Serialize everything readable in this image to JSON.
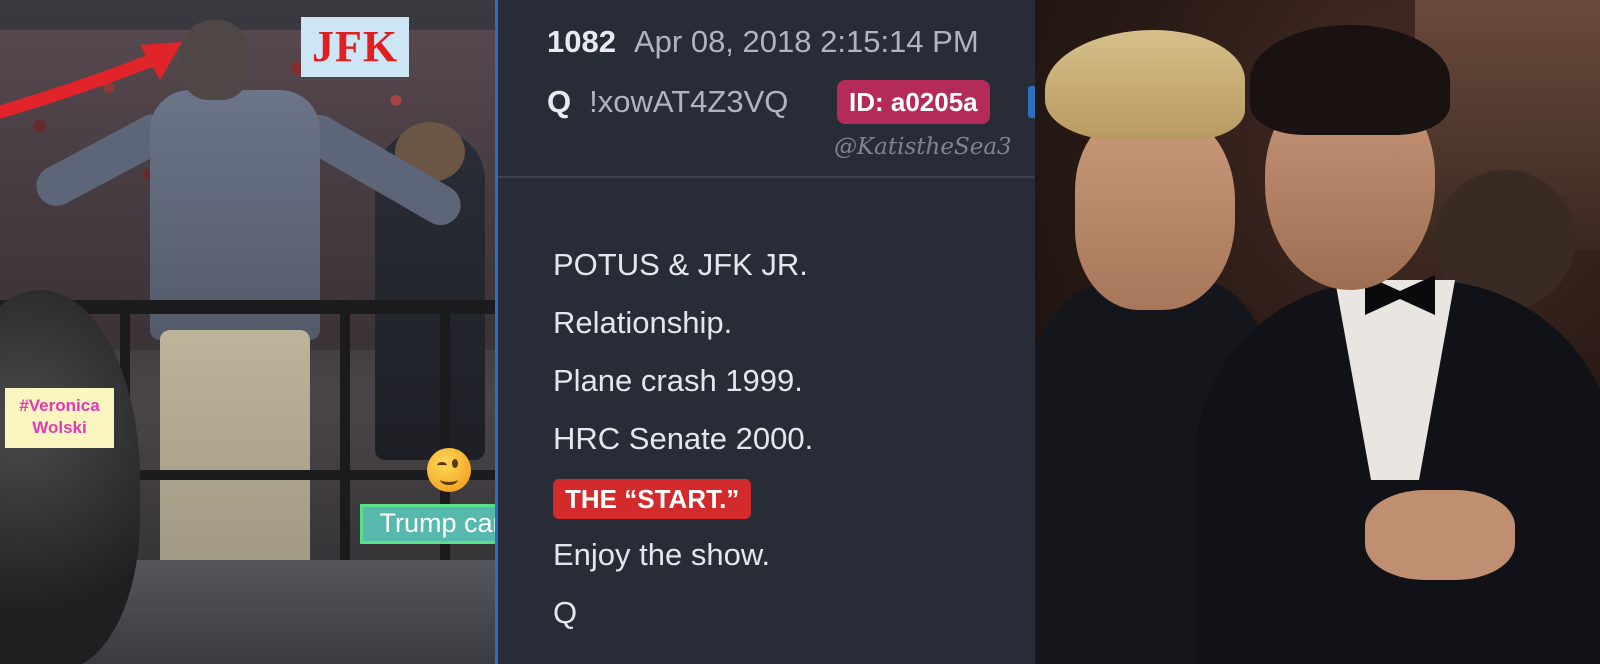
{
  "left_panel": {
    "jfk_label": "JFK",
    "veronica_line1": "#Veronica",
    "veronica_line2": "Wolski",
    "trump_card_label": "Trump card",
    "emoji": "winking-face"
  },
  "post": {
    "number": "1082",
    "date": "Apr 08, 2018 2:15:14 PM",
    "author": "Q",
    "tripcode": "!xowAT4Z3VQ",
    "id_badge": "ID: a0205a",
    "watermark": "@KatistheSea3",
    "lines": [
      "POTUS & JFK JR.",
      "Relationship.",
      "Plane crash 1999.",
      "HRC Senate 2000.",
      "THE “START.”",
      "Enjoy the show.",
      "Q"
    ]
  },
  "colors": {
    "post_background": "#282c36",
    "id_badge": "#b42a58",
    "start_badge": "#d32b2b",
    "jfk_text": "#e02020",
    "trump_card_bg": "#57b8ae",
    "divider": "#2b6fc1"
  }
}
